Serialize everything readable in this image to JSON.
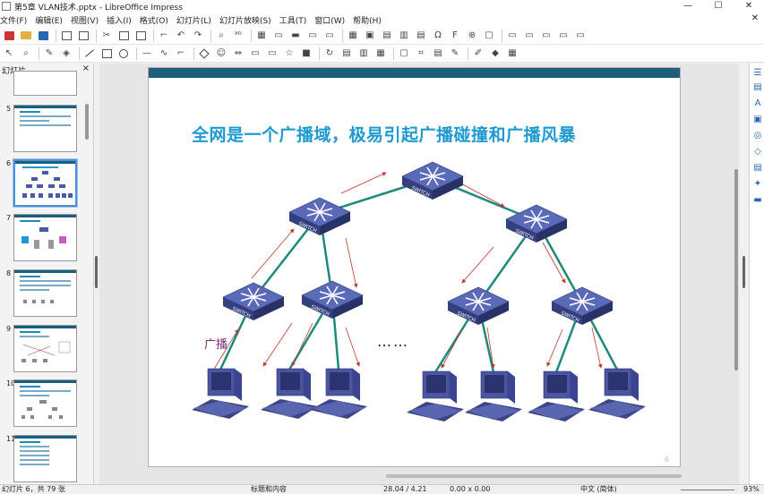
{
  "window": {
    "title": "第5章 VLAN技术.pptx - LibreOffice Impress",
    "minimize": "—",
    "maximize": "☐",
    "close": "✕"
  },
  "menubar": {
    "items": [
      "文件(F)",
      "编辑(E)",
      "视图(V)",
      "插入(I)",
      "格式(O)",
      "幻灯片(L)",
      "幻灯片放映(S)",
      "工具(T)",
      "窗口(W)",
      "帮助(H)"
    ],
    "close_doc": "✕"
  },
  "slides_panel": {
    "title": "幻灯片",
    "close": "×",
    "thumbnails": [
      {
        "number": "5"
      },
      {
        "number": "6"
      },
      {
        "number": "7"
      },
      {
        "number": "8"
      },
      {
        "number": "9"
      },
      {
        "number": "10"
      },
      {
        "number": "11"
      }
    ],
    "selected": "6"
  },
  "slide": {
    "title": "全网是一个广播域，极易引起广播碰撞和广播风暴",
    "broadcast_label": "广播",
    "ellipsis": "……",
    "switch_label": "SWITCH",
    "page_number": "6",
    "colors": {
      "title": "#1f9ad0",
      "header_bar": "#1f5f7c",
      "switch": "#4a5aa8",
      "link": "#1e8a7a",
      "arrow": "#c0392b",
      "pc": "#4b55a0"
    }
  },
  "statusbar": {
    "slide_info": "幻灯片 6，共 79 张",
    "layout": "标题和内容",
    "position": "28.04 / 4.21",
    "size": "0.00 x 0.00",
    "language": "中文 (简体)",
    "zoom": "93%"
  }
}
